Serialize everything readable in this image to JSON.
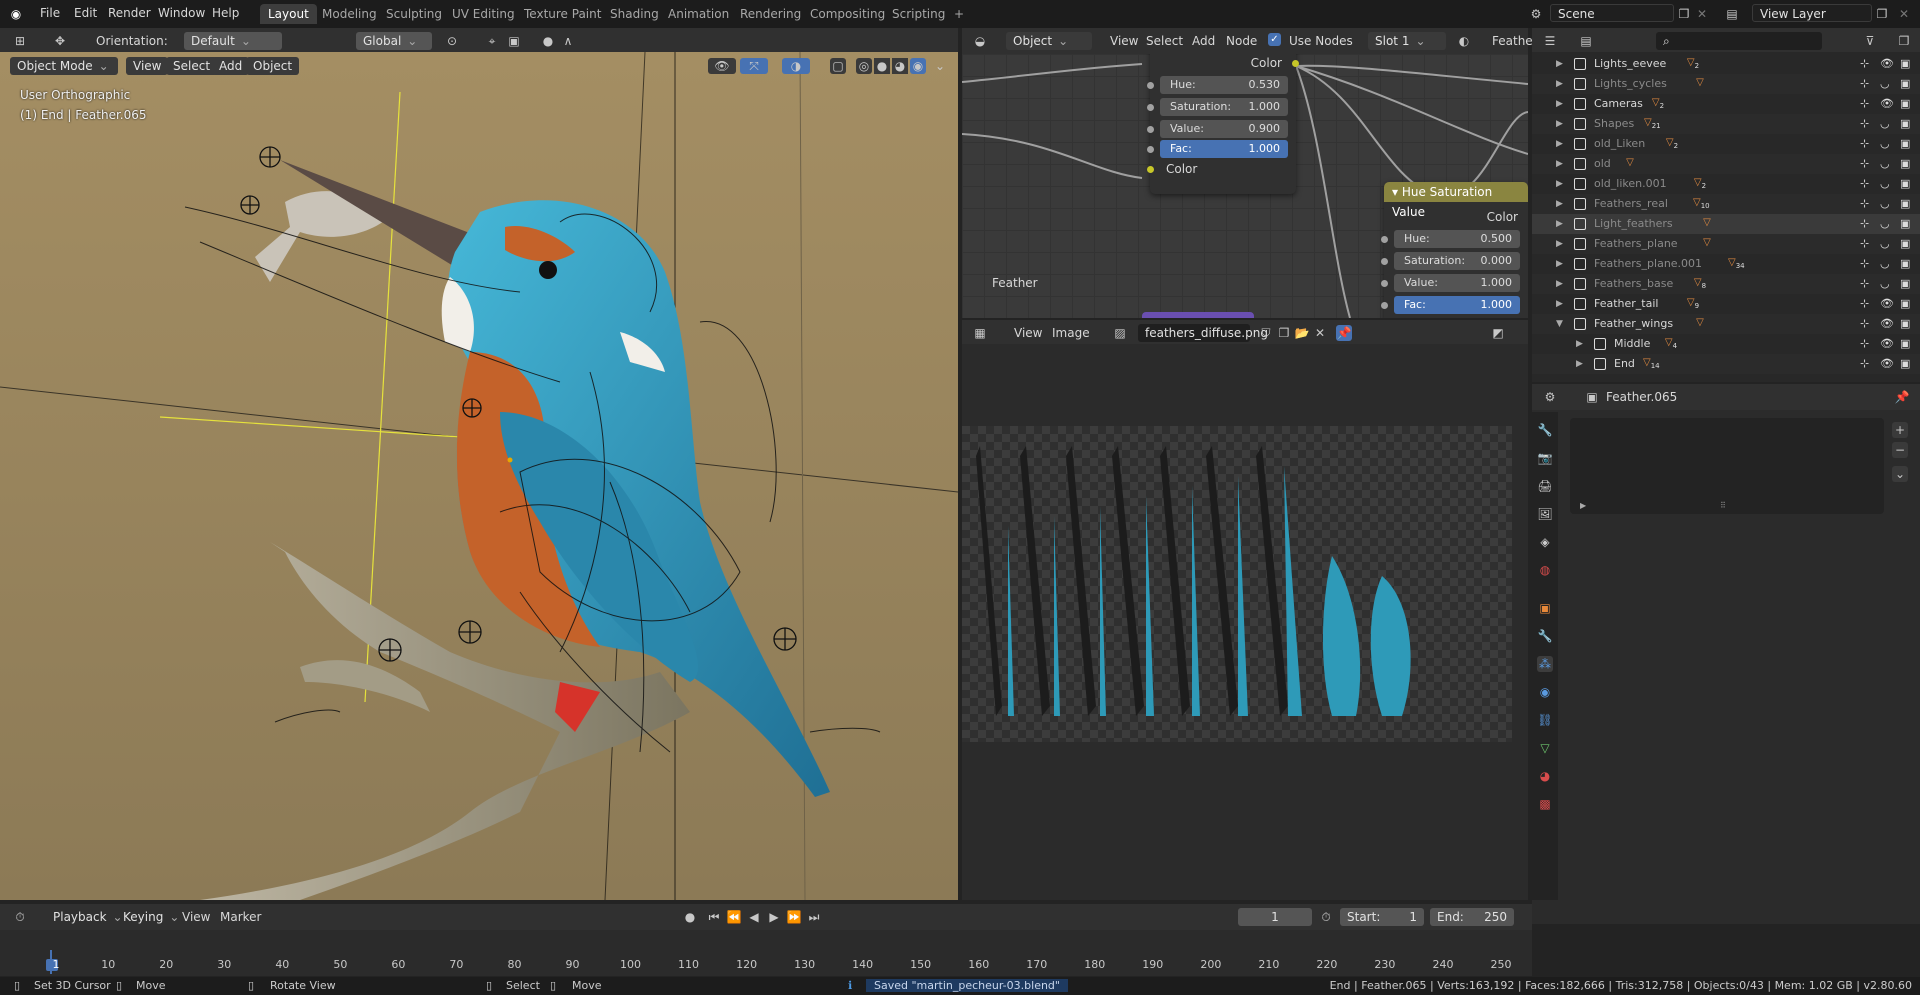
{
  "topbar": {
    "menus": [
      "File",
      "Edit",
      "Render",
      "Window",
      "Help"
    ],
    "workspaces": [
      "Layout",
      "Modeling",
      "Sculpting",
      "UV Editing",
      "Texture Paint",
      "Shading",
      "Animation",
      "Rendering",
      "Compositing",
      "Scripting"
    ],
    "active_workspace": "Layout",
    "add_tab": "+",
    "scene": "Scene",
    "view_layer": "View Layer"
  },
  "viewport_header": {
    "orientation_label": "Orientation:",
    "orientation_value": "Default",
    "transform_space": "Global",
    "mode": "Object Mode",
    "menus": [
      "View",
      "Select",
      "Add",
      "Object"
    ]
  },
  "viewport": {
    "view_name": "User Orthographic",
    "object_info": "(1) End | Feather.065"
  },
  "node_editor": {
    "type": "Object",
    "menus": [
      "View",
      "Select",
      "Add",
      "Node"
    ],
    "use_nodes_label": "Use Nodes",
    "use_nodes": true,
    "slot": "Slot 1",
    "material": "Feathe",
    "node1": {
      "output": "Color",
      "hue_label": "Hue:",
      "hue": "0.530",
      "sat_label": "Saturation:",
      "sat": "1.000",
      "val_label": "Value:",
      "val": "0.900",
      "fac_label": "Fac:",
      "fac": "1.000",
      "input": "Color"
    },
    "node2": {
      "title": "Hue Saturation Value",
      "output": "Color",
      "hue_label": "Hue:",
      "hue": "0.500",
      "sat_label": "Saturation:",
      "sat": "0.000",
      "val_label": "Value:",
      "val": "1.000",
      "fac_label": "Fac:",
      "fac": "1.000"
    },
    "frame_label": "Feather"
  },
  "image_editor": {
    "menus": [
      "View",
      "Image"
    ],
    "image_name": "feathers_diffuse.png",
    "feather_count": 11
  },
  "outliner": {
    "rows": [
      {
        "name": "Lights_eevee",
        "dim": false,
        "badge": "2",
        "expanded": false
      },
      {
        "name": "Lights_cycles",
        "dim": true,
        "badge": "",
        "expanded": false
      },
      {
        "name": "Cameras",
        "dim": false,
        "badge": "2",
        "expanded": false
      },
      {
        "name": "Shapes",
        "dim": true,
        "badge": "21",
        "expanded": false
      },
      {
        "name": "old_Liken",
        "dim": true,
        "badge": "2",
        "expanded": false
      },
      {
        "name": "old",
        "dim": true,
        "badge": "",
        "expanded": false
      },
      {
        "name": "old_liken.001",
        "dim": true,
        "badge": "2",
        "expanded": false
      },
      {
        "name": "Feathers_real",
        "dim": true,
        "badge": "10",
        "expanded": false
      },
      {
        "name": "Light_feathers",
        "dim": true,
        "badge": "",
        "expanded": false
      },
      {
        "name": "Feathers_plane",
        "dim": true,
        "badge": "",
        "expanded": false
      },
      {
        "name": "Feathers_plane.001",
        "dim": true,
        "badge": "34",
        "expanded": false
      },
      {
        "name": "Feathers_base",
        "dim": true,
        "badge": "8",
        "expanded": false
      },
      {
        "name": "Feather_tail",
        "dim": false,
        "badge": "9",
        "expanded": false
      },
      {
        "name": "Feather_wings",
        "dim": false,
        "badge": "",
        "expanded": true
      },
      {
        "name": "Middle",
        "dim": false,
        "badge": "4",
        "expanded": false
      },
      {
        "name": "End",
        "dim": false,
        "badge": "14",
        "expanded": false
      }
    ]
  },
  "properties": {
    "object_name": "Feather.065"
  },
  "timeline": {
    "menus": [
      "Playback",
      "Keying",
      "View",
      "Marker"
    ],
    "current_frame": "1",
    "start_label": "Start:",
    "start": "1",
    "end_label": "End:",
    "end": "250",
    "ticks": [
      "1",
      "10",
      "20",
      "30",
      "40",
      "50",
      "60",
      "70",
      "80",
      "90",
      "100",
      "110",
      "120",
      "130",
      "140",
      "150",
      "160",
      "170",
      "180",
      "190",
      "200",
      "210",
      "220",
      "230",
      "240",
      "250"
    ]
  },
  "statusbar": {
    "set_cursor": "Set 3D Cursor",
    "move": "Move",
    "rotate": "Rotate View",
    "select": "Select",
    "move2": "Move",
    "saved": "Saved \"martin_pecheur-03.blend\"",
    "stats": "End | Feather.065 | Verts:163,192 | Faces:182,666 | Tris:312,758 | Objects:0/43 | Mem: 1.02 GB | v2.80.60"
  },
  "colors": {
    "accent_blue": "#4772b3",
    "node_header": "#8a8540",
    "viewport_bg": "#9a8760",
    "kingfisher_blue": "#2b8fb0",
    "kingfisher_orange": "#c4622a"
  }
}
